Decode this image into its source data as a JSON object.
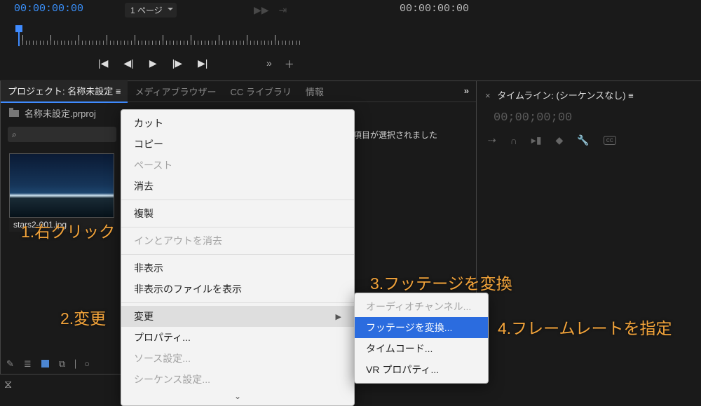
{
  "top": {
    "timecode_left": "00:00:00:00",
    "page_select": "1 ページ",
    "timecode_right": "00:00:00:00"
  },
  "tabs": {
    "project": "プロジェクト: 名称未設定",
    "media_browser": "メディアブラウザー",
    "cc_lib": "CC ライブラリ",
    "info": "情報"
  },
  "project": {
    "file": "名称未設定.prproj",
    "selection_text": "項目が選択されました",
    "clip_name": "stars2-001.jpg"
  },
  "context_menu": {
    "cut": "カット",
    "copy": "コピー",
    "paste": "ペースト",
    "clear": "消去",
    "duplicate": "複製",
    "clear_in_out": "インとアウトを消去",
    "hide": "非表示",
    "show_hidden": "非表示のファイルを表示",
    "modify": "変更",
    "properties": "プロパティ...",
    "source_settings": "ソース設定...",
    "sequence_settings": "シーケンス設定..."
  },
  "submenu": {
    "audio_channels": "オーディオチャンネル...",
    "interpret_footage": "フッテージを変換...",
    "timecode": "タイムコード...",
    "vr_properties": "VR プロパティ..."
  },
  "timeline_panel": {
    "title": "タイムライン: (シーケンスなし)",
    "timecode": "00;00;00;00"
  },
  "annotations": {
    "a1": "1.右クリック",
    "a2": "2.変更",
    "a3": "3.フッテージを変換",
    "a4": "4.フレームレートを指定"
  }
}
